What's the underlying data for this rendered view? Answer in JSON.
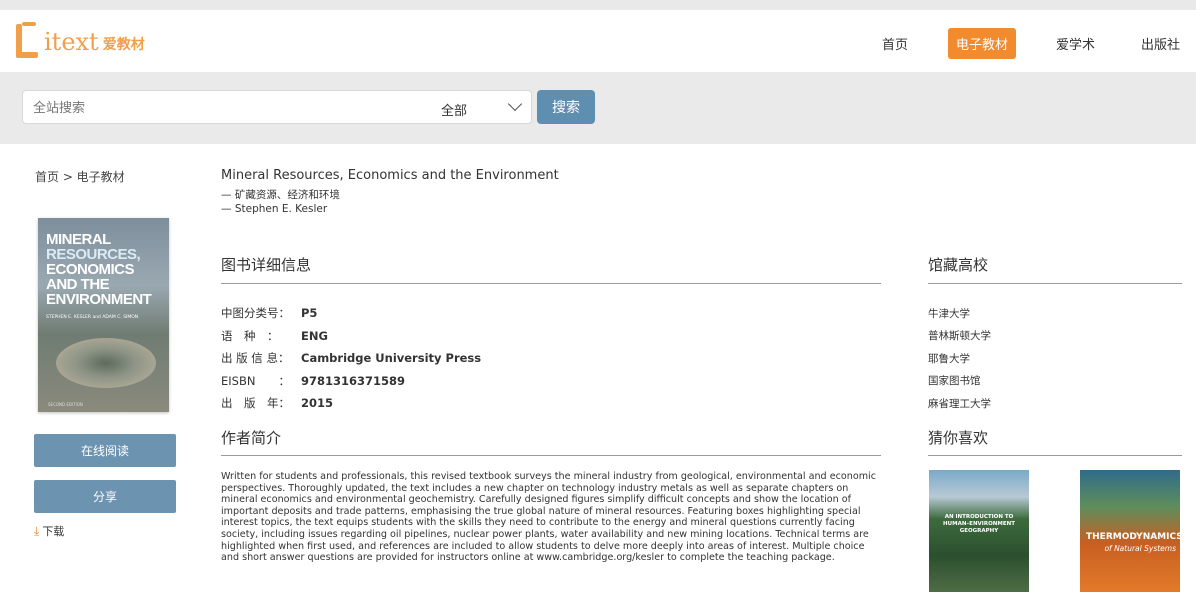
{
  "header": {
    "logo_text": "itext",
    "logo_sub": "爱教材",
    "nav": [
      "首页",
      "电子教材",
      "爱学术",
      "出版社"
    ],
    "nav_active": "电子教材",
    "accent_color": "#f28a2e"
  },
  "search": {
    "placeholder": "全站搜索",
    "scope": "全部",
    "button": "搜索"
  },
  "breadcrumb": "首页 > 电子教材",
  "book": {
    "title": "Mineral Resources, Economics and the Environment",
    "subtitle": "— 矿藏资源、经济和环境",
    "author": "— Stephen E. Kesler",
    "cover": {
      "title_lines": [
        "MINERAL",
        "RESOURCES,",
        "ECONOMICS",
        "AND THE",
        "ENVIRONMENT"
      ],
      "authors": "STEPHEN E. KESLER and ADAM C. SIMON",
      "edition": "SECOND EDITION"
    }
  },
  "actions": {
    "read": "在线阅读",
    "share": "分享",
    "download": "下载"
  },
  "details": {
    "heading": "图书详细信息",
    "rows": [
      {
        "label": "中图分类号：",
        "value": "P5"
      },
      {
        "label": "语　种　：",
        "value": "ENG"
      },
      {
        "label": "出 版 信 息：",
        "value": "Cambridge University Press"
      },
      {
        "label": "EISBN　　：",
        "value": "9781316371589"
      },
      {
        "label": "出　版　年：",
        "value": "2015"
      }
    ]
  },
  "author_intro": {
    "heading": "作者简介",
    "text": "Written for students and professionals, this revised textbook surveys the mineral industry from geological, environmental and economic perspectives. Thoroughly updated, the text includes a new chapter on technology industry metals as well as separate chapters on mineral economics and environmental geochemistry. Carefully designed figures simplify difficult concepts and show the location of important deposits and trade patterns, emphasising the true global nature of mineral resources. Featuring boxes highlighting special interest topics, the text equips students with the skills they need to contribute to the energy and mineral questions currently facing society, including issues regarding oil pipelines, nuclear power plants, water availability and new mining locations. Technical terms are highlighted when first used, and references are included to allow students to delve more deeply into areas of interest. Multiple choice and short answer questions are provided for instructors online at www.cambridge.org/kesler to complete the teaching package."
  },
  "libraries": {
    "heading": "馆藏高校",
    "items": [
      "牛津大学",
      "普林斯顿大学",
      "耶鲁大学",
      "国家图书馆",
      "麻省理工大学"
    ]
  },
  "recommend": {
    "heading": "猜你喜欢",
    "books": [
      {
        "title": "AN INTRODUCTION TO HUMAN–ENVIRONMENT GEOGRAPHY"
      },
      {
        "title": "THERMODYNAMICS",
        "sub": "of Natural Systems"
      }
    ]
  }
}
